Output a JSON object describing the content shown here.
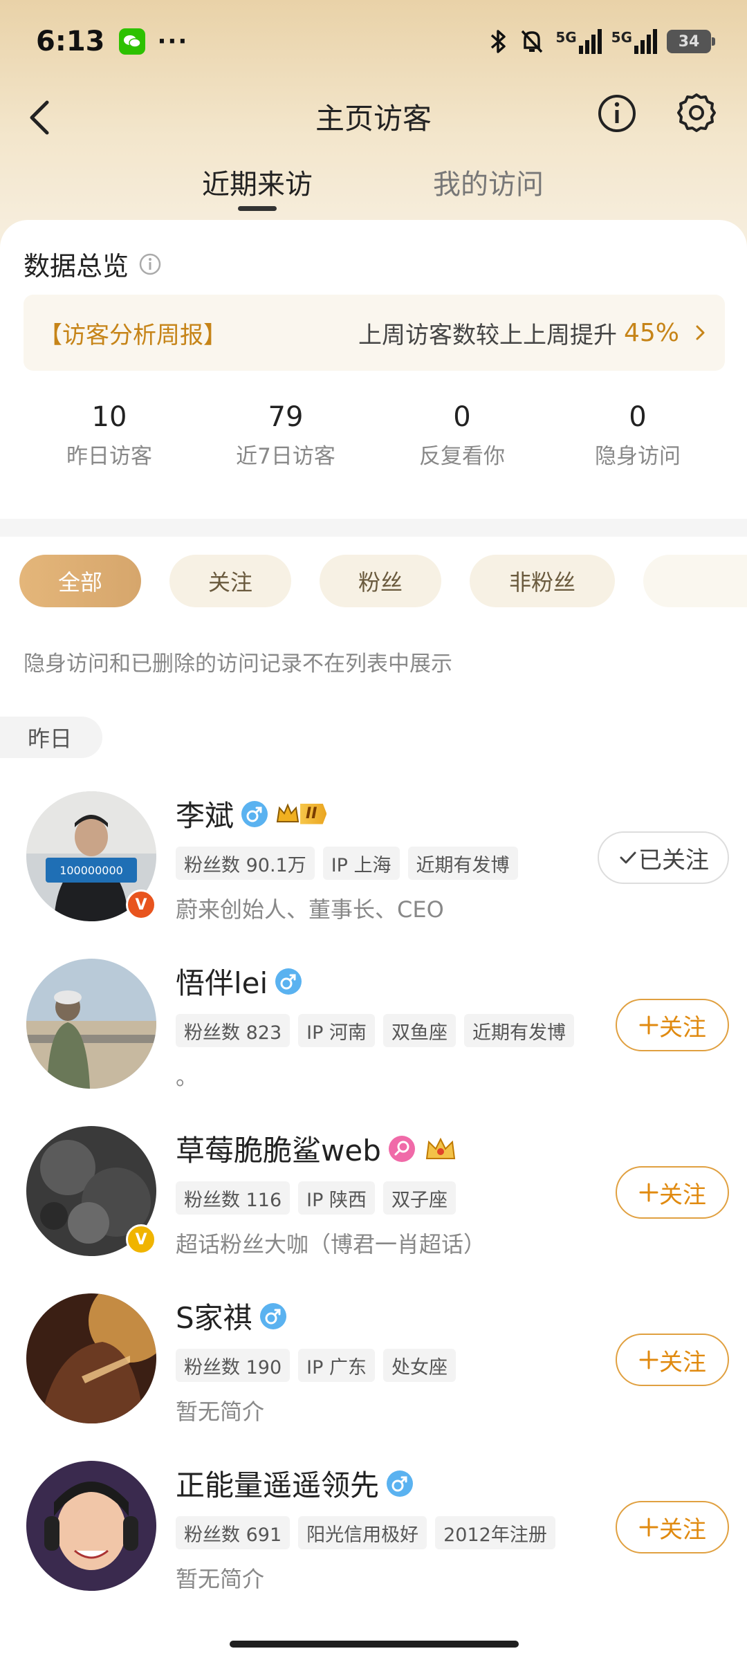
{
  "status_bar": {
    "time": "6:13",
    "battery": "34",
    "network_1": "5G",
    "network_2": "5G"
  },
  "header": {
    "title": "主页访客"
  },
  "tabs": [
    {
      "label": "近期来访"
    },
    {
      "label": "我的访问"
    }
  ],
  "overview": {
    "title": "数据总览",
    "weekly_label": "【访客分析周报】",
    "weekly_text": "上周访客数较上上周提升",
    "weekly_pct": "45%",
    "stats": [
      {
        "value": "10",
        "label": "昨日访客"
      },
      {
        "value": "79",
        "label": "近7日访客"
      },
      {
        "value": "0",
        "label": "反复看你"
      },
      {
        "value": "0",
        "label": "隐身访问"
      }
    ]
  },
  "filters": [
    "全部",
    "关注",
    "粉丝",
    "非粉丝"
  ],
  "notice": "隐身访问和已删除的访问记录不在列表中展示",
  "day_label": "昨日",
  "visitors": [
    {
      "name": "李斌",
      "tags": [
        "粉丝数 90.1万",
        "IP 上海",
        "近期有发博"
      ],
      "bio": "蔚来创始人、董事长、CEO",
      "button": "已关注",
      "badge": "V",
      "badge_color": "#e8541e",
      "rank": "II"
    },
    {
      "name": "悟伴lei",
      "tags": [
        "粉丝数 823",
        "IP 河南",
        "双鱼座",
        "近期有发博"
      ],
      "bio": "。",
      "button": "关注"
    },
    {
      "name": "草莓脆脆鲨web",
      "tags": [
        "粉丝数 116",
        "IP 陕西",
        "双子座"
      ],
      "bio": "超话粉丝大咖（博君一肖超话）",
      "button": "关注",
      "badge": "V",
      "badge_color": "#f0b400"
    },
    {
      "name": "S家祺",
      "tags": [
        "粉丝数 190",
        "IP 广东",
        "处女座"
      ],
      "bio": "暂无简介",
      "button": "关注"
    },
    {
      "name": "正能量遥遥领先",
      "tags": [
        "粉丝数 691",
        "阳光信用极好",
        "2012年注册"
      ],
      "bio": "暂无简介",
      "button": "关注"
    }
  ],
  "colors": {
    "accent": "#e08a10",
    "gold": "#c68418",
    "male_blue": "#5ab2f0",
    "female_pink": "#f06aa8"
  }
}
